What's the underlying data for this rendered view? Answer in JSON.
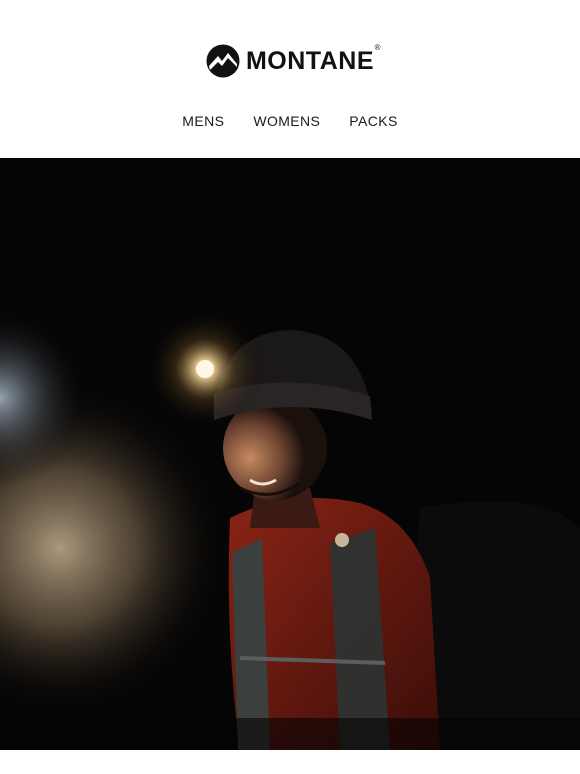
{
  "brand": {
    "name": "MONTANE",
    "registered": "®",
    "logo_icon": "mountain-circle-logo"
  },
  "nav": {
    "items": [
      {
        "label": "MENS"
      },
      {
        "label": "WOMENS"
      },
      {
        "label": "PACKS"
      }
    ]
  },
  "hero": {
    "subject": "hero-photo"
  }
}
